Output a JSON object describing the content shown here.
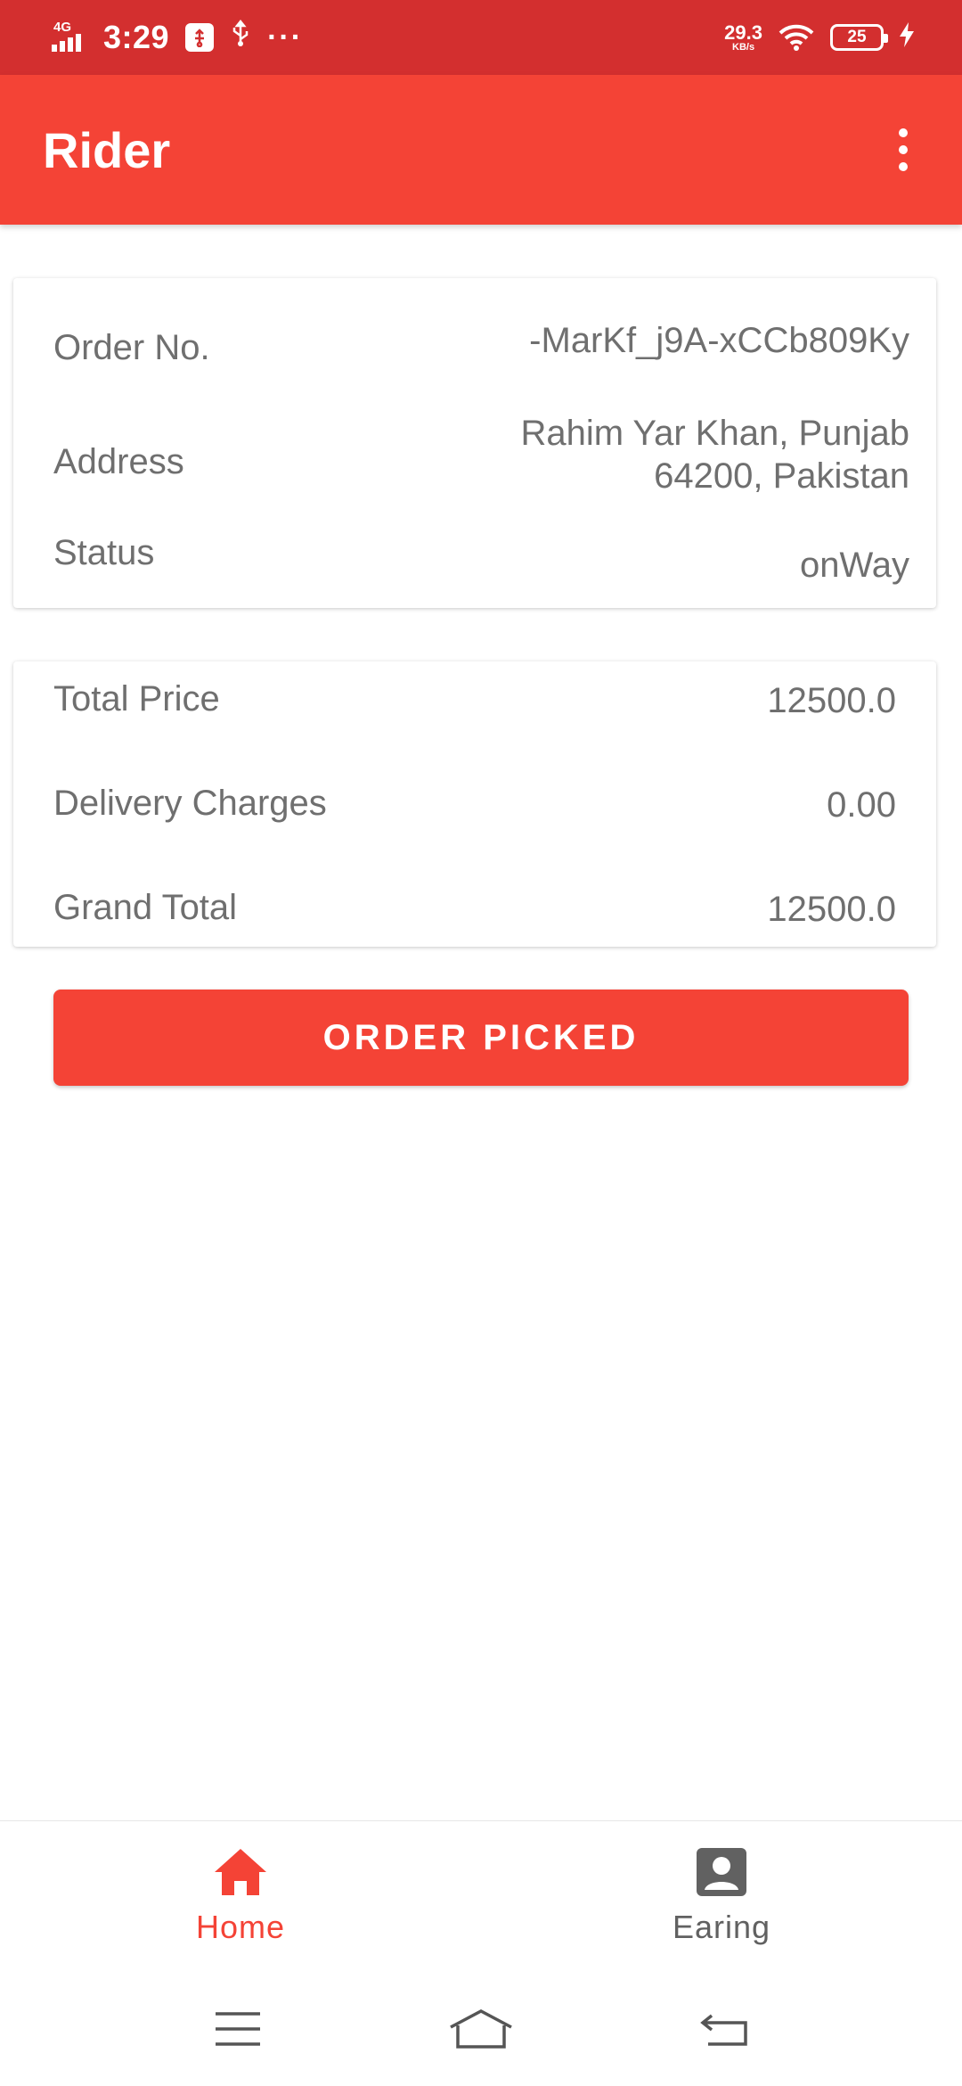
{
  "status_bar": {
    "network": "4G",
    "time": "3:29",
    "speed_value": "29.3",
    "speed_unit": "KB/s",
    "battery": "25",
    "icons": [
      "signal-icon",
      "usb-debug-icon",
      "usb-icon",
      "more-dots-icon",
      "wifi-icon",
      "battery-icon",
      "charging-bolt-icon"
    ]
  },
  "app_bar": {
    "title": "Rider",
    "menu_icon": "overflow-menu-icon"
  },
  "order_card": {
    "order_no_label": "Order No.",
    "order_no_value": "-MarKf_j9A-xCCb809Ky",
    "address_label": "Address",
    "address_line1": "Rahim Yar Khan, Punjab",
    "address_line2": "64200, Pakistan",
    "status_label": "Status",
    "status_value": "onWay"
  },
  "price_card": {
    "total_price_label": "Total Price",
    "total_price_value": "12500.0",
    "delivery_label": "Delivery Charges",
    "delivery_value": "0.00",
    "grand_total_label": "Grand Total",
    "grand_total_value": "12500.0"
  },
  "action": {
    "button_label": "ORDER PICKED"
  },
  "bottom_nav": {
    "items": [
      {
        "label": "Home",
        "icon": "home-icon",
        "active": true
      },
      {
        "label": "Earing",
        "icon": "account-box-icon",
        "active": false
      }
    ]
  },
  "colors": {
    "status_bar": "#d32f2f",
    "primary": "#f44336",
    "text_secondary": "#6f6f6f",
    "nav_inactive": "#616161"
  }
}
